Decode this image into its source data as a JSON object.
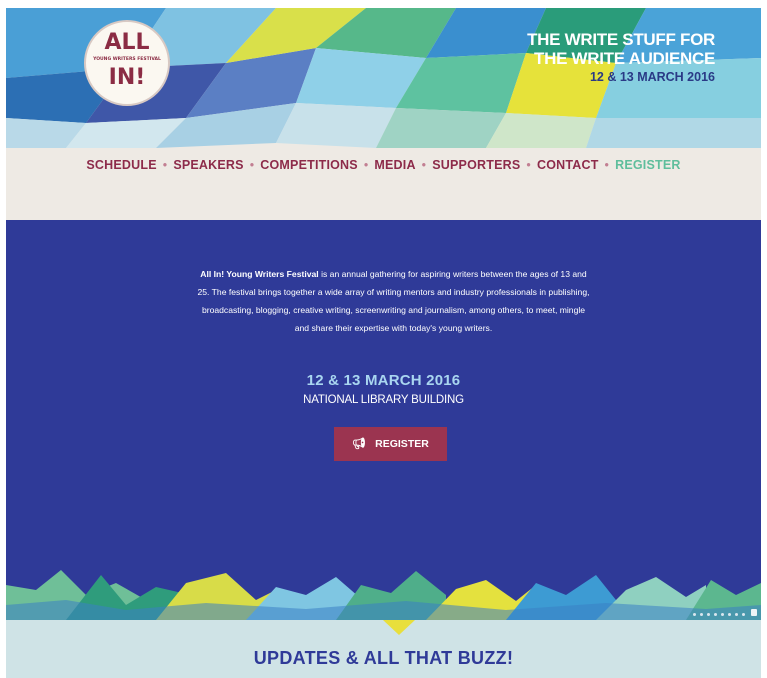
{
  "logo": {
    "top": "ALL",
    "sub": "YOUNG WRITERS FESTIVAL",
    "bottom": "IN!"
  },
  "tagline": {
    "line1": "THE WRITE STUFF FOR",
    "line2": "THE WRITE AUDIENCE",
    "dates": "12 & 13 MARCH 2016"
  },
  "nav": {
    "items": [
      "SCHEDULE",
      "SPEAKERS",
      "COMPETITIONS",
      "MEDIA",
      "SUPPORTERS",
      "CONTACT",
      "REGISTER"
    ],
    "separator": "•"
  },
  "hero": {
    "intro_bold": "All In! Young Writers Festival",
    "intro_rest": " is an annual gathering for aspiring writers between the ages of 13 and 25. The festival brings together a wide array of writing mentors and industry professionals in publishing, broadcasting, blogging, creative writing, screenwriting and journalism, among others, to meet, mingle and share their expertise with today's young writers.",
    "date": "12 & 13 MARCH 2016",
    "venue": "NATIONAL LIBRARY BUILDING",
    "register_label": "REGISTER",
    "register_icon": "megaphone-icon"
  },
  "buzz": {
    "title": "UPDATES & ALL THAT BUZZ!"
  },
  "colors": {
    "hero_bg": "#2f3a98",
    "accent_red": "#9b3450",
    "nav_text": "#8d2b4a",
    "nav_register": "#5fbe9c",
    "buzz_bg": "#cfe3e6"
  }
}
